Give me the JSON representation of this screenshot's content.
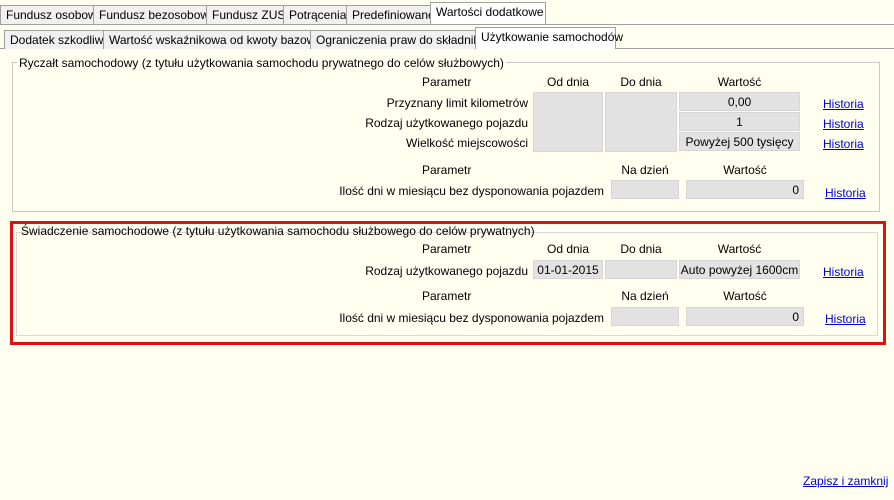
{
  "tabs_top": [
    "Fundusz osobowy",
    "Fundusz bezosobowy",
    "Fundusz ZUS",
    "Potrącenia",
    "Predefiniowane",
    "Wartości dodatkowe"
  ],
  "tabs_sub": [
    "Dodatek szkodliwy",
    "Wartość wskaźnikowa od kwoty bazowej",
    "Ograniczenia praw do składnika",
    "Użytkowanie samochodów"
  ],
  "ryczalt": {
    "title": "Ryczałt samochodowy (z tytułu użytkowania samochodu prywatnego do celów służbowych)",
    "header": {
      "param": "Parametr",
      "from": "Od dnia",
      "to": "Do dnia",
      "value": "Wartość"
    },
    "rows": [
      {
        "label": "Przyznany limit kilometrów",
        "from": "",
        "to": "",
        "value": "0,00",
        "link": "Historia"
      },
      {
        "label": "Rodzaj użytkowanego pojazdu",
        "from": "",
        "to": "",
        "value": "1",
        "link": "Historia"
      },
      {
        "label": "Wielkość miejscowości",
        "from": "",
        "to": "",
        "value": "Powyżej 500 tysięcy",
        "link": "Historia"
      }
    ],
    "header2": {
      "param": "Parametr",
      "date": "Na dzień",
      "value": "Wartość"
    },
    "row2": {
      "label": "Ilość dni w miesiącu bez dysponowania pojazdem",
      "date": "",
      "value": "0",
      "link": "Historia"
    }
  },
  "swiadczenie": {
    "title": "Świadczenie samochodowe (z tytułu użytkowania samochodu służbowego do celów prywatnych)",
    "header": {
      "param": "Parametr",
      "from": "Od dnia",
      "to": "Do dnia",
      "value": "Wartość"
    },
    "row": {
      "label": "Rodzaj użytkowanego pojazdu",
      "from": "01-01-2015",
      "to": "",
      "value": "Auto powyżej 1600cm",
      "link": "Historia"
    },
    "header2": {
      "param": "Parametr",
      "date": "Na dzień",
      "value": "Wartość"
    },
    "row2": {
      "label": "Ilość dni w miesiącu bez dysponowania pojazdem",
      "date": "",
      "value": "0",
      "link": "Historia"
    }
  },
  "save_close": "Zapisz i zamknij",
  "highlight_color": "#e01010"
}
